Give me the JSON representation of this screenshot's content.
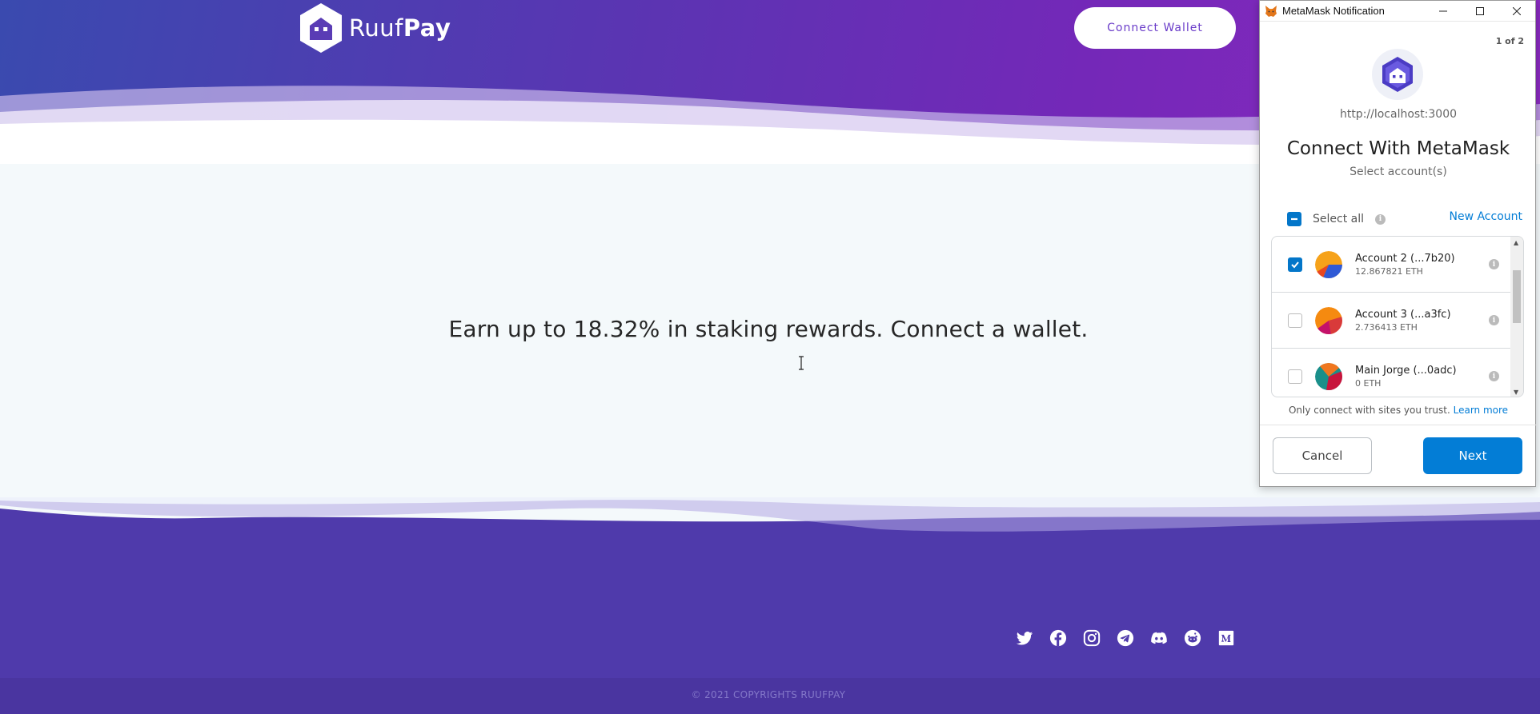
{
  "site": {
    "brand_light": "Ruuf",
    "brand_bold": "Pay",
    "connect_wallet_label": "Connect Wallet",
    "headline": "Earn up to 18.32% in staking rewards. Connect a wallet.",
    "copyright": "© 2021 COPYRIGHTS RUUFPAY",
    "socials": [
      "twitter-icon",
      "facebook-icon",
      "instagram-icon",
      "telegram-icon",
      "discord-icon",
      "reddit-icon",
      "medium-icon"
    ],
    "colors": {
      "hero_start": "#3a4aaf",
      "hero_end": "#8a2ac0",
      "footer": "#4f3aab"
    }
  },
  "metamask": {
    "window_title": "MetaMask Notification",
    "pager": "1 of 2",
    "site_url": "http://localhost:3000",
    "heading": "Connect With MetaMask",
    "subheading": "Select account(s)",
    "select_all_label": "Select all",
    "new_account_label": "New Account",
    "accounts": [
      {
        "name": "Account 2 (...7b20)",
        "balance": "12.867821 ETH",
        "checked": true
      },
      {
        "name": "Account 3 (...a3fc)",
        "balance": "2.736413 ETH",
        "checked": false
      },
      {
        "name": "Main Jorge (...0adc)",
        "balance": "0 ETH",
        "checked": false
      }
    ],
    "trust_text": "Only connect with sites you trust.",
    "learn_more_label": "Learn more",
    "cancel_label": "Cancel",
    "next_label": "Next",
    "accent_color": "#037dd6"
  }
}
